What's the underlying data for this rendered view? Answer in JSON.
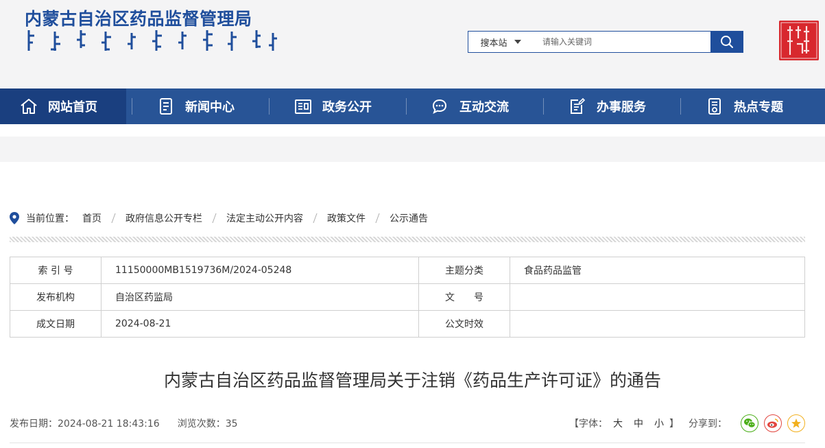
{
  "site": {
    "title_cn": "内蒙古自治区药品监督管理局",
    "seal_text": "内蒙古"
  },
  "search": {
    "scope": "搜本站",
    "placeholder": "请输入关键词"
  },
  "nav": {
    "items": [
      {
        "label": "网站首页",
        "icon": "home-icon"
      },
      {
        "label": "新闻中心",
        "icon": "news-icon"
      },
      {
        "label": "政务公开",
        "icon": "government-affairs-icon"
      },
      {
        "label": "互动交流",
        "icon": "chat-icon"
      },
      {
        "label": "办事服务",
        "icon": "service-icon"
      },
      {
        "label": "热点专题",
        "icon": "topic-icon"
      }
    ]
  },
  "breadcrumb": {
    "label": "当前位置：",
    "items": [
      "首页",
      "政府信息公开专栏",
      "法定主动公开内容",
      "政策文件",
      "公示通告"
    ]
  },
  "meta": {
    "index_no_label": "索 引 号",
    "index_no": "11150000MB1519736M/2024-05248",
    "subject_label": "主题分类",
    "subject": "食品药品监管",
    "publisher_label": "发布机构",
    "publisher": "自治区药监局",
    "doc_no_label": "文　　号",
    "doc_no": "",
    "date_label": "成文日期",
    "date": "2024-08-21",
    "validity_label": "公文时效",
    "validity": ""
  },
  "article": {
    "title": "内蒙古自治区药品监督管理局关于注销《药品生产许可证》的通告",
    "publish_date_label": "发布日期：",
    "publish_date": "2024-08-21 18:43:16",
    "views_label": "浏览次数：",
    "views": "35"
  },
  "toolbar": {
    "font_label": "【字体：",
    "font_large": "大",
    "font_medium": "中",
    "font_small": "小",
    "font_end": "】",
    "share_label": "分享到："
  },
  "colors": {
    "brand": "#1f4e9c",
    "nav_bg": "#285496",
    "nav_active": "#1a3f7f",
    "wechat": "#4caf1a",
    "weibo": "#e2463f",
    "favorite": "#f2b01e"
  }
}
